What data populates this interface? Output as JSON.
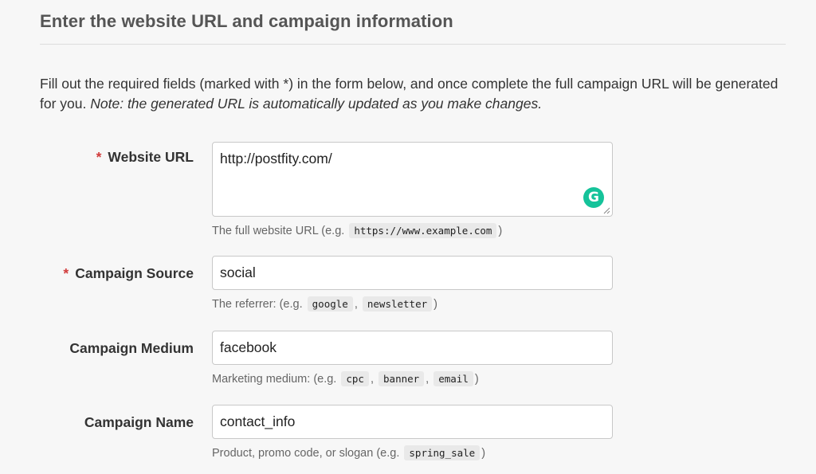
{
  "section": {
    "title": "Enter the website URL and campaign information",
    "intro_main": "Fill out the required fields (marked with *) in the form below, and once complete the full campaign URL will be generated for you.",
    "intro_note": "Note: the generated URL is automatically updated as you make changes."
  },
  "fields": {
    "website_url": {
      "required_mark": "*",
      "label": "Website URL",
      "value": "http://postfity.com/",
      "help_prefix": "The full website URL (e.g.",
      "help_examples": [
        "https://www.example.com"
      ],
      "help_suffix": ")",
      "extension_icon": "grammarly-icon",
      "extension_letter": "G"
    },
    "campaign_source": {
      "required_mark": "*",
      "label": "Campaign Source",
      "value": "social",
      "help_prefix": "The referrer: (e.g.",
      "help_examples": [
        "google",
        "newsletter"
      ],
      "help_suffix": ")"
    },
    "campaign_medium": {
      "label": "Campaign Medium",
      "value": "facebook",
      "help_prefix": "Marketing medium: (e.g.",
      "help_examples": [
        "cpc",
        "banner",
        "email"
      ],
      "help_suffix": ")"
    },
    "campaign_name": {
      "label": "Campaign Name",
      "value": "contact_info",
      "help_prefix": "Product, promo code, or slogan (e.g.",
      "help_examples": [
        "spring_sale"
      ],
      "help_suffix": ")"
    }
  },
  "colors": {
    "required": "#d13b3b",
    "grammarly": "#15c39a"
  }
}
